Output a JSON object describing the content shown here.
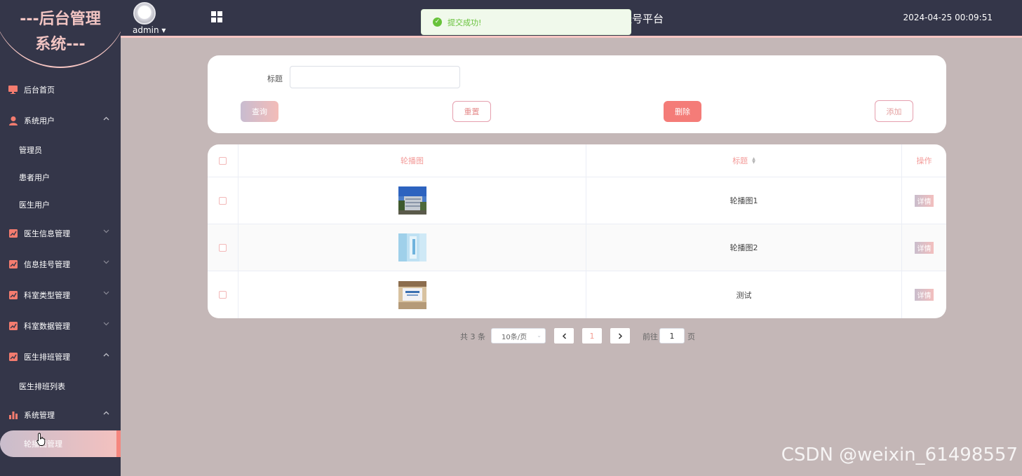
{
  "sidebar": {
    "logo": [
      "---后台管理",
      "系统---"
    ],
    "menu": {
      "home": "后台首页",
      "sys_users": "系统用户",
      "admin": "管理员",
      "patients": "患者用户",
      "doctors": "医生用户",
      "doctor_info": "医生信息管理",
      "reg_info": "信息挂号管理",
      "dept_type": "科室类型管理",
      "dept_data": "科室数据管理",
      "schedule": "医生排班管理",
      "schedule_list": "医生排班列表",
      "sys_manage": "系统管理",
      "carousel": "轮播图管理"
    }
  },
  "header": {
    "user": "admin ▾",
    "title": "挂号平台",
    "time": "2024-04-25 00:09:51"
  },
  "toast": {
    "text": "提交成功!",
    "type": "success"
  },
  "search": {
    "label": "标题",
    "value": "",
    "buttons": {
      "query": "查询",
      "reset": "重置",
      "delete": "删除",
      "add": "添加"
    }
  },
  "table": {
    "headers": {
      "image": "轮播图",
      "title": "标题",
      "op": "操作"
    },
    "rows": [
      {
        "title": "轮播图1",
        "action": "详情",
        "image": "building-photo"
      },
      {
        "title": "轮播图2",
        "action": "详情",
        "image": "blue-abstract-photo"
      },
      {
        "title": "测试",
        "action": "详情",
        "image": "lobby-photo"
      }
    ]
  },
  "pagination": {
    "total": "共 3 条",
    "page_size": "10条/页",
    "current": "1",
    "goto_label": "前往",
    "goto_value": "1",
    "page_suffix": "页"
  },
  "watermark": "CSDN @weixin_61498557",
  "colors": {
    "sidebar_bg": "#343649",
    "main_bg": "#c4b7b7",
    "accent": "#f39a98",
    "danger": "#f47c78",
    "success": "#67c23a"
  }
}
